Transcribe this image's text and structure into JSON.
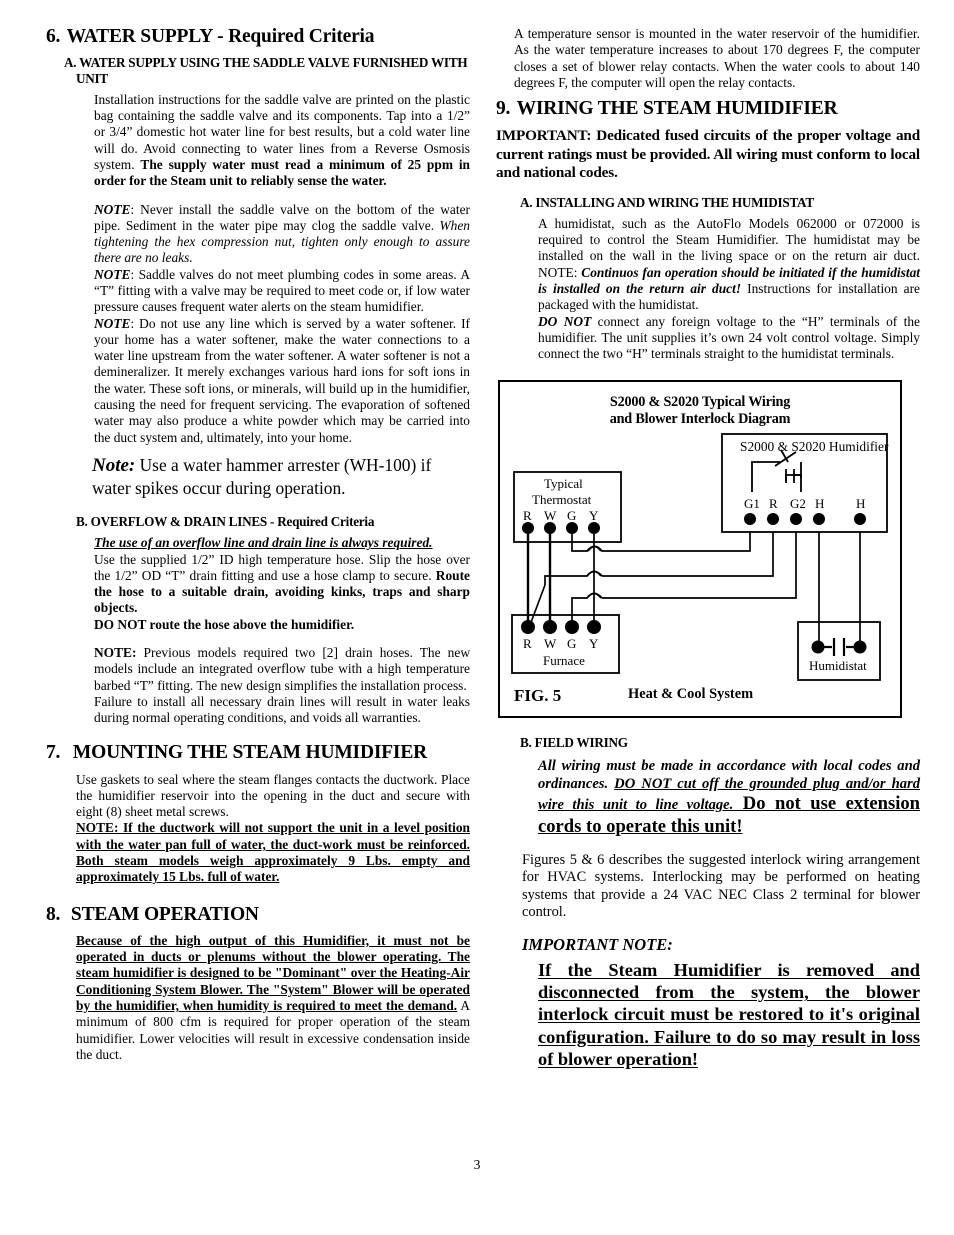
{
  "page": {
    "number": "3"
  },
  "left_column": {
    "section6": {
      "number": "6.",
      "title": "WATER SUPPLY - Required Criteria",
      "sub_a": "A. WATER SUPPLY USING THE SADDLE VALVE FURNISHED WITH UNIT",
      "para1_plain": "Installation instructions for the saddle valve are printed on the plastic bag containing the saddle valve and its components. Tap into a 1/2” or 3/4” domestic hot water line for best results, but a cold water line will do. Avoid connecting to water lines from a Reverse Osmosis system. ",
      "para1_bold": "The supply water must read a minimum of 25 ppm in order for the Steam unit to reliably sense the water.",
      "note1_label": "NOTE",
      "note1_text": ": Never install the saddle valve on the bottom of the water pipe. Sediment in the water pipe may clog the saddle valve. ",
      "note1_italic": "When tightening the hex compression nut, tighten only enough to assure there are no leaks.",
      "note2_label": "NOTE",
      "note2_text": ": Saddle valves do not meet plumbing codes in some areas. A “T” fitting with a valve may be required to meet code or, if low water pressure causes frequent water alerts on the steam humidifier.",
      "note3_label": "NOTE",
      "note3_text": ": Do not use any line which is served by a water softener. If your home has a water softener, make the water connections to a water line upstream from the water softener. A water softener is not a demineralizer. It merely exchanges various hard ions for soft ions in the water. These soft ions, or minerals, will build up in the humidifier, causing the need for frequent servicing. The evaporation of softened water may also produce a white powder which may be carried into the duct system and, ultimately, into your home.",
      "bignote_label": "Note:",
      "bignote_text": " Use a water hammer arrester (WH-100) if water spikes occur during operation.",
      "sub_b": "B. OVERFLOW & DRAIN LINES - Required Criteria",
      "b_underline": "The use of an overflow line and drain line is always required.",
      "b_para_plain": "Use the supplied 1/2” ID high temperature hose. Slip the hose over the 1/2” OD “T” drain fitting and use a hose clamp to secure. ",
      "b_para_bold": "Route the hose to a suitable drain, avoiding kinks, traps and sharp objects.",
      "b_donot": "DO NOT route the hose above the humidifier.",
      "b_note_label": "NOTE:",
      "b_note_text": " Previous models required two [2] drain hoses. The new models include an integrated overflow tube with a high temperature barbed “T” fitting. The new design simplifies the installation process.",
      "b_note2": "Failure to install all necessary drain lines will result in water leaks during normal operating conditions, and voids all warranties."
    },
    "section7": {
      "number": "7.",
      "title": "MOUNTING THE STEAM HUMIDIFIER",
      "para1": "Use gaskets to seal where the steam flanges contacts the ductwork. Place the humidifier reservoir into the opening in the duct and secure with eight (8) sheet metal screws.",
      "note_bold_underline": "NOTE: If the ductwork will not support the unit in a level position with the water pan full of water, the duct-work must be reinforced. Both steam models weigh approximately 9 Lbs. empty and approximately 15 Lbs. full of water."
    },
    "section8": {
      "number": "8.",
      "title": "STEAM OPERATION",
      "bold_underline": "Because of the high output of this Humidifier, it must not be operated in ducts or plenums without the blower operating. The steam humidifier is designed to be \"Dominant\" over the Heating-Air Conditioning System Blower. The \"System\" Blower will be operated by the humidifier, when humidity is required to meet the demand.",
      "plain_tail": " A minimum of 800 cfm is required for proper operation of the steam humidifier. Lower velocities will result in excessive condensation inside the duct."
    }
  },
  "right_column": {
    "intro_para": "A temperature sensor is mounted in the water reservoir of the humidifier. As the water temperature increases to about 170 degrees F, the computer closes a set of blower relay contacts. When the water cools to about 140 degrees F, the  computer will open the relay contacts.",
    "section9": {
      "number": "9.",
      "title": "WIRING THE STEAM HUMIDIFIER",
      "important": "IMPORTANT: Dedicated fused circuits of the proper voltage and current ratings must be provided. All wiring must conform to local and national codes.",
      "sub_a": "A. INSTALLING AND WIRING THE HUMIDISTAT",
      "a_para_plain1": "A humidistat, such as the AutoFlo Models 062000 or 072000 is required to control the Steam Humidifier. The humidistat may be installed on the wall in the living space or on the return air duct. NOTE: ",
      "a_para_bolditalic": "Continuos fan operation should be initiated if the humidistat is installed on the return air duct!",
      "a_para_plain2": " Instructions for installation are packaged with the humidistat.",
      "a_donot_label": "DO NOT",
      "a_donot_text": " connect any foreign voltage to the “H” terminals of the humidifier. The unit supplies it’s own 24 volt control voltage. Simply connect the two “H” terminals straight to the humidistat terminals.",
      "sub_b": "B. FIELD WIRING",
      "b_italic_part1": "All wiring must be made in accordance with local codes and ordinances. ",
      "b_italic_underline": "DO NOT cut off the grounded plug and/or hard wire this unit to line voltage.",
      "b_big_underline": " Do not use extension cords to operate this unit!",
      "figures_para": "Figures 5 & 6 describes the suggested interlock wiring arrangement for HVAC systems. Interlocking may be performed on heating systems that provide a 24 VAC NEC Class 2 terminal for blower control.",
      "important_note_label": "IMPORTANT NOTE:",
      "important_note_text": "If the Steam Humidifier is removed and disconnected from the system, the blower interlock circuit must be restored to it's original configuration. Failure to do so may result in loss of blower operation!"
    }
  },
  "figure": {
    "id": "FIG. 5",
    "title_line1": "S2000 & S2020 Typical Wiring",
    "title_line2": "and Blower Interlock Diagram",
    "system_label": "Heat & Cool System",
    "humidifier_box_label": "S2000 & S2020 Humidifier",
    "humidifier_terminals": [
      "G1",
      "R",
      "G2",
      "H",
      "H"
    ],
    "thermostat_box_label_line1": "Typical",
    "thermostat_box_label_line2": "Thermostat",
    "thermostat_terminals": [
      "R",
      "W",
      "G",
      "Y"
    ],
    "furnace_box_label": "Furnace",
    "furnace_terminals": [
      "R",
      "W",
      "G",
      "Y"
    ],
    "humidistat_box_label": "Humidistat"
  }
}
